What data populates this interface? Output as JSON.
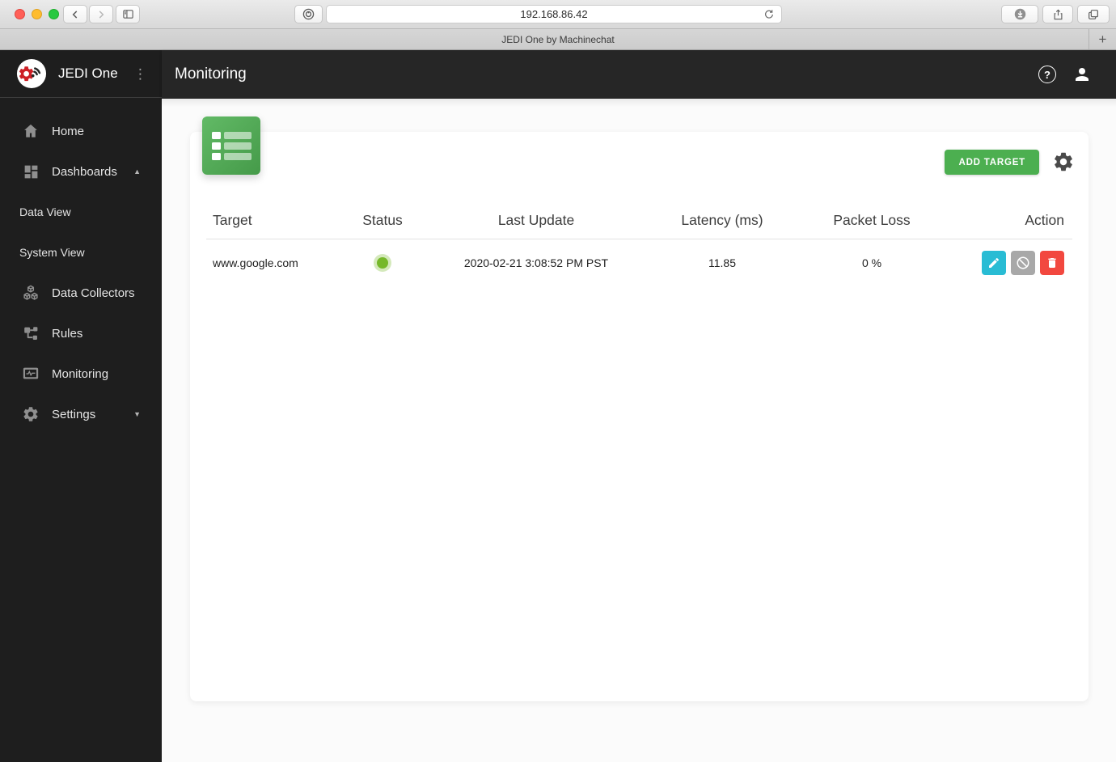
{
  "browser": {
    "url": "192.168.86.42",
    "tab_title": "JEDI One by Machinechat",
    "new_tab_label": "+"
  },
  "icons": {
    "kebab": "⋮",
    "caret_up": "▲",
    "caret_down": "▼",
    "help": "?"
  },
  "sidebar": {
    "brand": "JEDI One",
    "items": [
      {
        "label": "Home"
      },
      {
        "label": "Dashboards"
      },
      {
        "label": "Data View"
      },
      {
        "label": "System View"
      },
      {
        "label": "Data Collectors"
      },
      {
        "label": "Rules"
      },
      {
        "label": "Monitoring"
      },
      {
        "label": "Settings"
      }
    ]
  },
  "header": {
    "title": "Monitoring"
  },
  "monitoring": {
    "add_target_label": "ADD TARGET",
    "columns": [
      "Target",
      "Status",
      "Last Update",
      "Latency (ms)",
      "Packet Loss",
      "Action"
    ],
    "rows": [
      {
        "target": "www.google.com",
        "status": "up",
        "last_update": "2020-02-21 3:08:52 PM PST",
        "latency": "11.85",
        "packet_loss": "0 %"
      }
    ]
  },
  "colors": {
    "accent_green": "#4caf50",
    "status_up": "#76b82a",
    "edit_button": "#29bcd4",
    "disable_button": "#a8a8a8",
    "delete_button": "#f2483f",
    "sidebar_bg": "#1e1e1e",
    "appbar_bg": "#262626"
  }
}
